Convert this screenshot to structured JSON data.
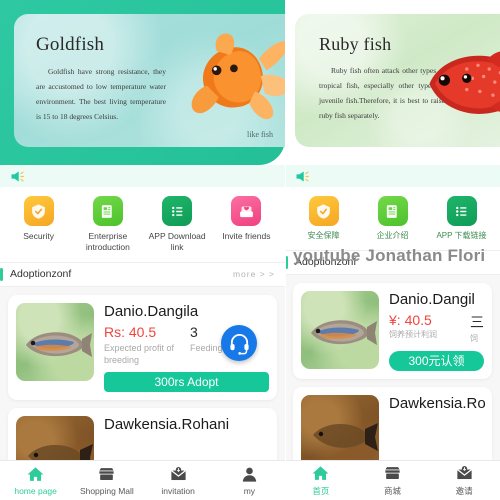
{
  "watermark": {
    "text": "youtube Jonathan Flori"
  },
  "left": {
    "banner": {
      "title": "Goldfish",
      "body": "Goldfish have strong resistance, they are accustomed to low temperature water environment. The best living temperature is 15 to 18 degrees Celsius.",
      "like_label": "like fish",
      "fish_icon": "goldfish-illustration"
    },
    "notice": {
      "icon": "speaker-icon",
      "text": ""
    },
    "quick_links": [
      {
        "label": "Security",
        "icon": "shield-check-icon",
        "color": "#f5a623"
      },
      {
        "label": "Enterprise introduction",
        "icon": "document-icon",
        "color": "#4cc22c"
      },
      {
        "label": "APP Download link",
        "icon": "list-icon",
        "color": "#0f9c56"
      },
      {
        "label": "Invite friends",
        "icon": "invite-icon",
        "color": "#f0417f"
      }
    ],
    "section": {
      "title": "Adoptionzonf",
      "more": "more > >"
    },
    "cards": [
      {
        "name": "Danio.Dangila",
        "price": "Rs: 40.5",
        "price_caption": "Expected profit of breeding",
        "period": "3",
        "period_caption": "Feeding period",
        "button": "300rs Adopt",
        "thumb": "danio"
      },
      {
        "name": "Dawkensia.Rohani",
        "price": "",
        "price_caption": "",
        "period": "",
        "period_caption": "",
        "button": "",
        "thumb": "dawk"
      }
    ],
    "service_button": {
      "icon": "headset-icon"
    },
    "tabs": [
      {
        "label": "home page",
        "icon": "home-icon",
        "active": true
      },
      {
        "label": "Shopping Mall",
        "icon": "store-icon",
        "active": false
      },
      {
        "label": "invitation",
        "icon": "envelope-icon",
        "active": false
      },
      {
        "label": "my",
        "icon": "person-icon",
        "active": false
      }
    ]
  },
  "right": {
    "banner": {
      "title": "Ruby fish",
      "body": "Ruby fish often attack other types of tropical fish, especially other types of juvenile fish.Therefore, it is best to raise ruby fish separately.",
      "fish_icon": "rubyfish-illustration"
    },
    "notice": {
      "icon": "speaker-icon",
      "text": ""
    },
    "quick_links": [
      {
        "label": "安全保障",
        "icon": "shield-check-icon",
        "color": "#f5a623"
      },
      {
        "label": "企业介绍",
        "icon": "document-icon",
        "color": "#4cc22c"
      },
      {
        "label": "APP 下载链接",
        "icon": "list-icon",
        "color": "#0f9c56"
      }
    ],
    "section": {
      "title": "Adoptionzonf",
      "more": ""
    },
    "cards": [
      {
        "name": "Danio.Dangil",
        "price": "¥: 40.5",
        "price_caption": "饲养预计利润",
        "period": "三",
        "period_caption": "饲",
        "button": "300元认领",
        "thumb": "danio"
      },
      {
        "name": "Dawkensia.Ro",
        "price": "",
        "price_caption": "",
        "period": "",
        "period_caption": "",
        "button": "",
        "thumb": "dawk"
      }
    ],
    "tabs": [
      {
        "label": "首页",
        "icon": "home-icon",
        "active": true
      },
      {
        "label": "商城",
        "icon": "store-icon",
        "active": false
      },
      {
        "label": "邀请",
        "icon": "envelope-icon",
        "active": false
      }
    ]
  }
}
